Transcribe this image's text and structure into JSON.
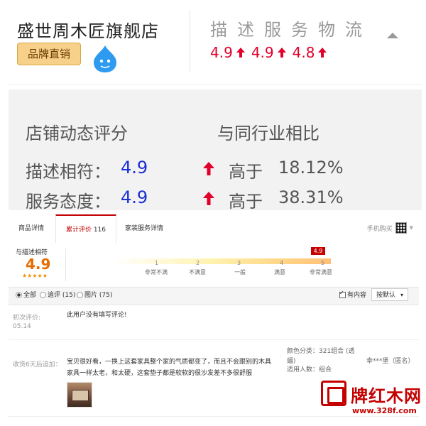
{
  "shop": {
    "name": "盛世周木匠旗舰店",
    "badge": "品牌直销"
  },
  "header_ratings": {
    "title": "描述服务物流",
    "values": [
      "4.9",
      "4.9",
      "4.8"
    ]
  },
  "score_panel": {
    "left_title": "店铺动态评分",
    "right_title": "与同行业相比",
    "rows": [
      {
        "label": "描述相符：",
        "value": "4.9",
        "compare": "高于",
        "percent": "18.12%"
      },
      {
        "label": "服务态度：",
        "value": "4.9",
        "compare": "高于",
        "percent": "38.31%"
      }
    ]
  },
  "tabs": [
    {
      "label": "商品详情"
    },
    {
      "label": "累计评价",
      "count": "116"
    },
    {
      "label": "家装服务详情"
    }
  ],
  "mobile_buy": "手机购买",
  "match": {
    "label": "与描述相符",
    "score": "4.9",
    "stars": "★★★★★",
    "flag": "4.9",
    "ticks": [
      "1",
      "2",
      "3",
      "4",
      "5"
    ],
    "tick_labels": [
      "非常不满",
      "不满意",
      "一般",
      "满意",
      "非常满意"
    ]
  },
  "filters": {
    "all": "全部",
    "followup": "追评 (15)",
    "images": "图片 (75)",
    "has_content": "有内容",
    "sort": "按默认"
  },
  "reviews": [
    {
      "label": "初次评价:",
      "date": "05.14",
      "text": "此用户没有填写评论!"
    },
    {
      "label": "收货6天后追加：",
      "text_line1": "宝贝很好看，一换上这套家具整个家的气质都变了，而且不会跟别的木具",
      "text_line2": "家具一样太老，和太硬，这套垫子都是软软的很沙发差不多很舒服",
      "color_label": "颜色分类：321组合 (透",
      "color_label2": "蝠)",
      "people_label": "适用人数：组合",
      "user": "幸***堡（匿名）"
    }
  ],
  "watermark": {
    "brand": "牌红木网",
    "url": "www.328f.com"
  }
}
